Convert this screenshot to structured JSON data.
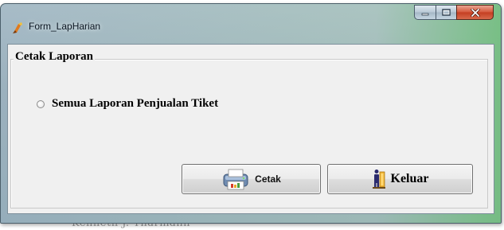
{
  "window": {
    "title": "Form_LapHarian",
    "app_icon": "app-logo-icon",
    "controls": {
      "minimize_icon": "minimize-icon",
      "maximize_icon": "maximize-icon",
      "close_icon": "close-icon"
    }
  },
  "group": {
    "title": "Cetak Laporan",
    "options": [
      {
        "label": "Semua Laporan Penjualan Tiket",
        "selected": false
      }
    ]
  },
  "buttons": {
    "print": {
      "label": "Cetak",
      "icon": "printer-icon"
    },
    "exit": {
      "label": "Keluar",
      "icon": "exit-door-icon"
    }
  },
  "colors": {
    "client_bg": "#f0f0f0",
    "close_button": "#c43c20",
    "frame_accent": "#6ebe78"
  }
}
